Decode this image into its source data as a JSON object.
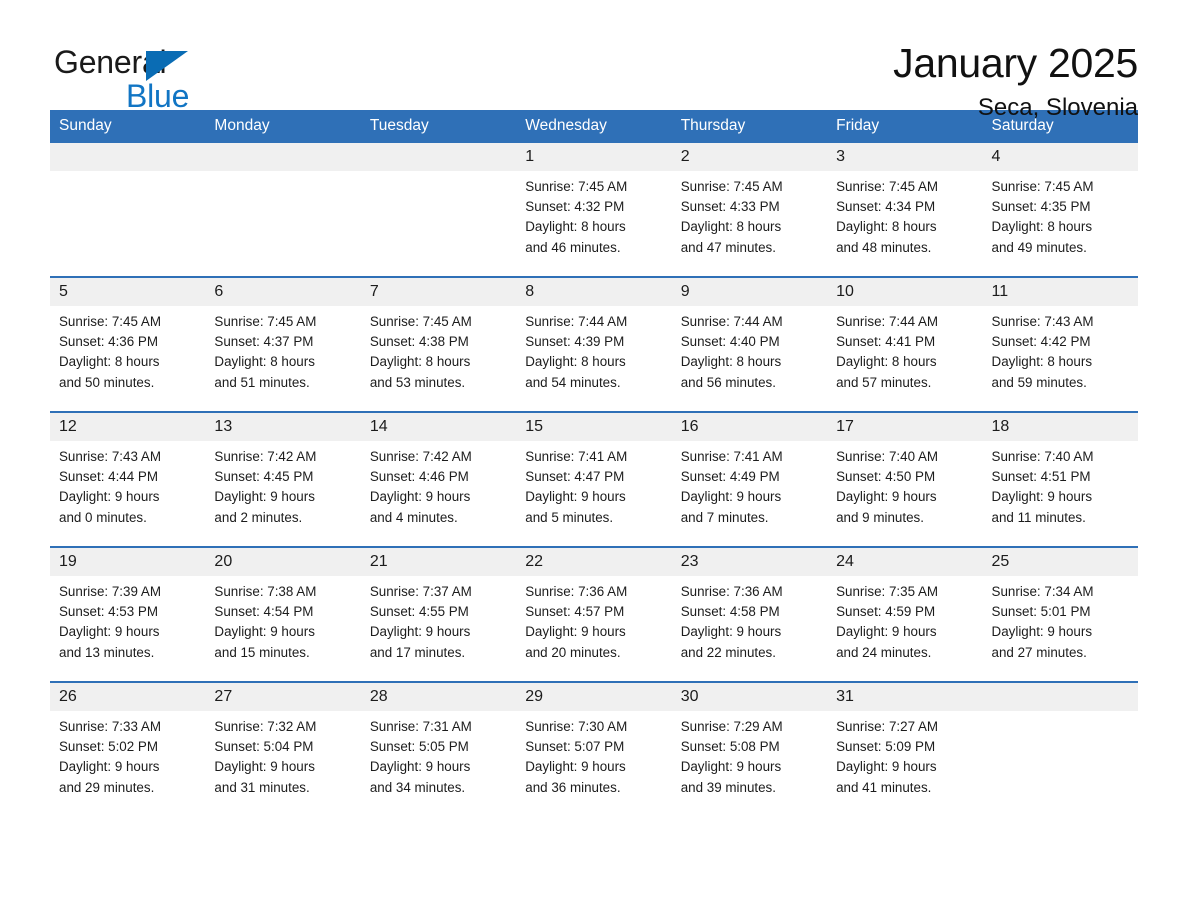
{
  "logo": {
    "word_one": "General",
    "word_two": "Blue",
    "triangle_icon": "triangle-icon",
    "brand_blue": "#1175c4",
    "triangle_blue": "#0a6cb4"
  },
  "header": {
    "title": "January 2025",
    "subtitle": "Seca, Slovenia"
  },
  "theme": {
    "header_blue": "#2f70b7",
    "daynum_gray": "#f0f0f0",
    "text": "#1c1c1c"
  },
  "calendar": {
    "weekday_headers": [
      "Sunday",
      "Monday",
      "Tuesday",
      "Wednesday",
      "Thursday",
      "Friday",
      "Saturday"
    ],
    "weeks": [
      [
        {
          "day": "",
          "info": ""
        },
        {
          "day": "",
          "info": ""
        },
        {
          "day": "",
          "info": ""
        },
        {
          "day": "1",
          "info": "Sunrise: 7:45 AM\nSunset: 4:32 PM\nDaylight: 8 hours\nand 46 minutes."
        },
        {
          "day": "2",
          "info": "Sunrise: 7:45 AM\nSunset: 4:33 PM\nDaylight: 8 hours\nand 47 minutes."
        },
        {
          "day": "3",
          "info": "Sunrise: 7:45 AM\nSunset: 4:34 PM\nDaylight: 8 hours\nand 48 minutes."
        },
        {
          "day": "4",
          "info": "Sunrise: 7:45 AM\nSunset: 4:35 PM\nDaylight: 8 hours\nand 49 minutes."
        }
      ],
      [
        {
          "day": "5",
          "info": "Sunrise: 7:45 AM\nSunset: 4:36 PM\nDaylight: 8 hours\nand 50 minutes."
        },
        {
          "day": "6",
          "info": "Sunrise: 7:45 AM\nSunset: 4:37 PM\nDaylight: 8 hours\nand 51 minutes."
        },
        {
          "day": "7",
          "info": "Sunrise: 7:45 AM\nSunset: 4:38 PM\nDaylight: 8 hours\nand 53 minutes."
        },
        {
          "day": "8",
          "info": "Sunrise: 7:44 AM\nSunset: 4:39 PM\nDaylight: 8 hours\nand 54 minutes."
        },
        {
          "day": "9",
          "info": "Sunrise: 7:44 AM\nSunset: 4:40 PM\nDaylight: 8 hours\nand 56 minutes."
        },
        {
          "day": "10",
          "info": "Sunrise: 7:44 AM\nSunset: 4:41 PM\nDaylight: 8 hours\nand 57 minutes."
        },
        {
          "day": "11",
          "info": "Sunrise: 7:43 AM\nSunset: 4:42 PM\nDaylight: 8 hours\nand 59 minutes."
        }
      ],
      [
        {
          "day": "12",
          "info": "Sunrise: 7:43 AM\nSunset: 4:44 PM\nDaylight: 9 hours\nand 0 minutes."
        },
        {
          "day": "13",
          "info": "Sunrise: 7:42 AM\nSunset: 4:45 PM\nDaylight: 9 hours\nand 2 minutes."
        },
        {
          "day": "14",
          "info": "Sunrise: 7:42 AM\nSunset: 4:46 PM\nDaylight: 9 hours\nand 4 minutes."
        },
        {
          "day": "15",
          "info": "Sunrise: 7:41 AM\nSunset: 4:47 PM\nDaylight: 9 hours\nand 5 minutes."
        },
        {
          "day": "16",
          "info": "Sunrise: 7:41 AM\nSunset: 4:49 PM\nDaylight: 9 hours\nand 7 minutes."
        },
        {
          "day": "17",
          "info": "Sunrise: 7:40 AM\nSunset: 4:50 PM\nDaylight: 9 hours\nand 9 minutes."
        },
        {
          "day": "18",
          "info": "Sunrise: 7:40 AM\nSunset: 4:51 PM\nDaylight: 9 hours\nand 11 minutes."
        }
      ],
      [
        {
          "day": "19",
          "info": "Sunrise: 7:39 AM\nSunset: 4:53 PM\nDaylight: 9 hours\nand 13 minutes."
        },
        {
          "day": "20",
          "info": "Sunrise: 7:38 AM\nSunset: 4:54 PM\nDaylight: 9 hours\nand 15 minutes."
        },
        {
          "day": "21",
          "info": "Sunrise: 7:37 AM\nSunset: 4:55 PM\nDaylight: 9 hours\nand 17 minutes."
        },
        {
          "day": "22",
          "info": "Sunrise: 7:36 AM\nSunset: 4:57 PM\nDaylight: 9 hours\nand 20 minutes."
        },
        {
          "day": "23",
          "info": "Sunrise: 7:36 AM\nSunset: 4:58 PM\nDaylight: 9 hours\nand 22 minutes."
        },
        {
          "day": "24",
          "info": "Sunrise: 7:35 AM\nSunset: 4:59 PM\nDaylight: 9 hours\nand 24 minutes."
        },
        {
          "day": "25",
          "info": "Sunrise: 7:34 AM\nSunset: 5:01 PM\nDaylight: 9 hours\nand 27 minutes."
        }
      ],
      [
        {
          "day": "26",
          "info": "Sunrise: 7:33 AM\nSunset: 5:02 PM\nDaylight: 9 hours\nand 29 minutes."
        },
        {
          "day": "27",
          "info": "Sunrise: 7:32 AM\nSunset: 5:04 PM\nDaylight: 9 hours\nand 31 minutes."
        },
        {
          "day": "28",
          "info": "Sunrise: 7:31 AM\nSunset: 5:05 PM\nDaylight: 9 hours\nand 34 minutes."
        },
        {
          "day": "29",
          "info": "Sunrise: 7:30 AM\nSunset: 5:07 PM\nDaylight: 9 hours\nand 36 minutes."
        },
        {
          "day": "30",
          "info": "Sunrise: 7:29 AM\nSunset: 5:08 PM\nDaylight: 9 hours\nand 39 minutes."
        },
        {
          "day": "31",
          "info": "Sunrise: 7:27 AM\nSunset: 5:09 PM\nDaylight: 9 hours\nand 41 minutes."
        },
        {
          "day": "",
          "info": ""
        }
      ]
    ]
  }
}
